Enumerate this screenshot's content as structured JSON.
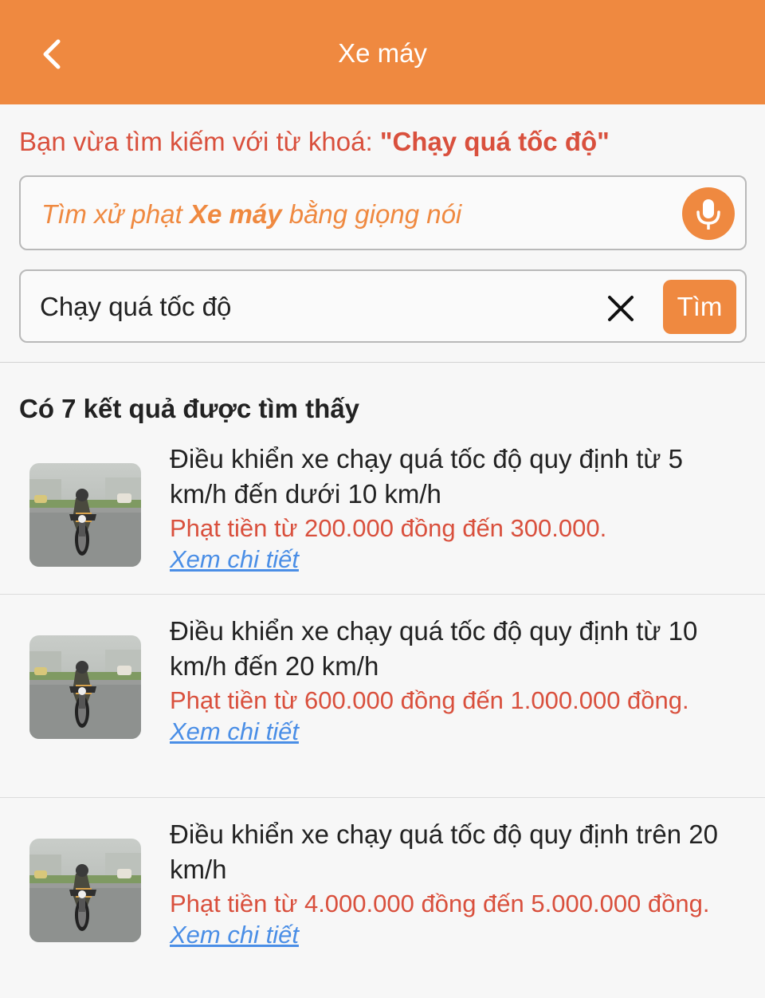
{
  "header": {
    "title": "Xe máy",
    "back_icon": "chevron-left-icon"
  },
  "search_note": {
    "prefix": "Bạn vừa tìm kiếm với từ khoá: ",
    "keyword": "\"Chạy quá tốc độ\""
  },
  "voice_search": {
    "placeholder_prefix": "Tìm xử phạt ",
    "placeholder_bold": "Xe máy",
    "placeholder_suffix": " bằng giọng nói",
    "icon": "microphone-icon"
  },
  "query": {
    "value": "Chạy quá tốc độ",
    "clear_icon": "close-icon",
    "button_label": "Tìm"
  },
  "results": {
    "count_label": "Có 7 kết quả được tìm thấy",
    "items": [
      {
        "title": "Điều khiển xe chạy quá tốc độ quy định từ 5 km/h đến dưới 10 km/h",
        "fine": "Phạt tiền từ 200.000 đồng đến 300.000.",
        "link": "Xem chi tiết"
      },
      {
        "title": "Điều khiển xe chạy quá tốc độ quy định từ 10 km/h đến 20 km/h",
        "fine": "Phạt tiền từ 600.000 đồng đến 1.000.000 đồng.",
        "link": "Xem chi tiết"
      },
      {
        "title": "Điều khiển xe chạy quá tốc độ quy định trên 20 km/h",
        "fine": "Phạt tiền từ 4.000.000 đồng đến 5.000.000 đồng.",
        "link": "Xem chi tiết"
      }
    ]
  },
  "colors": {
    "accent": "#ef8940",
    "danger_text": "#d9503d",
    "link": "#4a8ee6"
  }
}
